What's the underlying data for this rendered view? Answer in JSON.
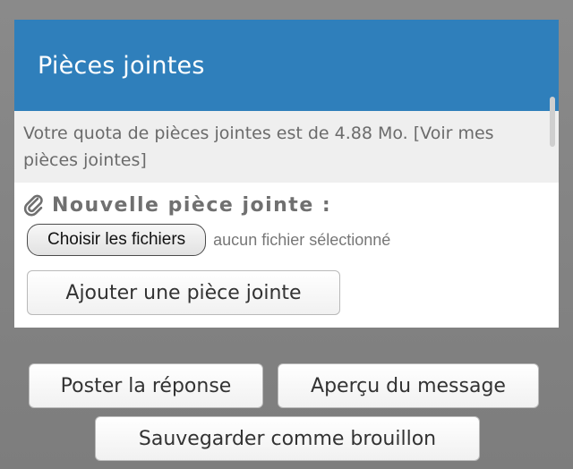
{
  "panel": {
    "title": "Pièces jointes",
    "quota_text": "Votre quota de pièces jointes est de 4.88 Mo.",
    "quota_link": "[Voir mes pièces jointes]",
    "new_attachment_heading": "Nouvelle pièce jointe :",
    "choose_files_label": "Choisir les fichiers",
    "no_file_selected": "aucun fichier sélectionné",
    "add_attachment_label": "Ajouter une pièce jointe"
  },
  "actions": {
    "post_reply": "Poster la réponse",
    "preview_message": "Aperçu du message",
    "save_draft": "Sauvegarder comme brouillon"
  },
  "colors": {
    "header_bg": "#2f7fbb",
    "page_bg": "#858585"
  },
  "icons": {
    "attachment": "paperclip-icon"
  }
}
